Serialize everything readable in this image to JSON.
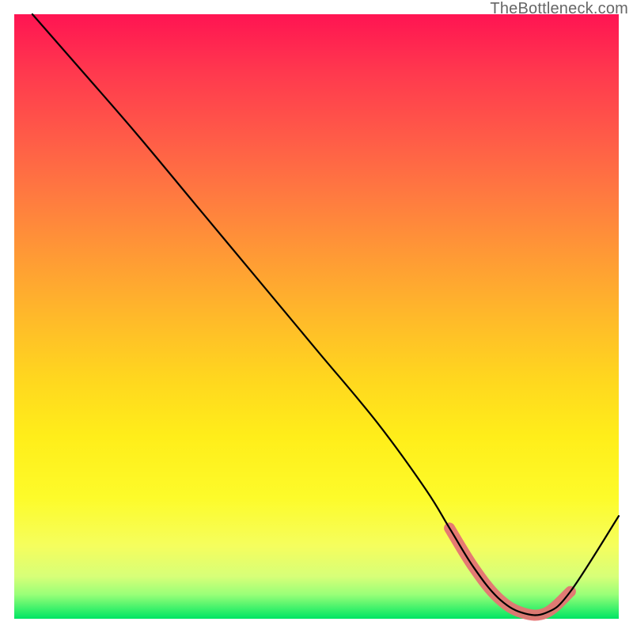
{
  "watermark": "TheBottleneck.com",
  "chart_data": {
    "type": "line",
    "title": "",
    "xlabel": "",
    "ylabel": "",
    "xlim": [
      0,
      100
    ],
    "ylim": [
      0,
      100
    ],
    "grid": false,
    "series": [
      {
        "name": "bottleneck-curve",
        "x": [
          3,
          10,
          20,
          30,
          40,
          50,
          60,
          68,
          72,
          76,
          80,
          84,
          88,
          92,
          100
        ],
        "y": [
          100,
          92,
          80.5,
          68.5,
          56.5,
          44.5,
          32.5,
          21.5,
          15,
          8.5,
          3.5,
          1.0,
          1.0,
          4.5,
          17
        ]
      }
    ],
    "highlight_band": {
      "name": "optimal-range",
      "x": [
        72,
        76,
        80,
        84,
        88,
        92
      ],
      "y": [
        15,
        8.5,
        3.5,
        1.0,
        1.0,
        4.5
      ],
      "color": "#e57373"
    },
    "background_gradient": {
      "orientation": "vertical",
      "stops": [
        {
          "pos": 0.0,
          "color": "#ff1452"
        },
        {
          "pos": 0.5,
          "color": "#ffb92a"
        },
        {
          "pos": 0.8,
          "color": "#fdfb2a"
        },
        {
          "pos": 1.0,
          "color": "#00e564"
        }
      ]
    }
  }
}
